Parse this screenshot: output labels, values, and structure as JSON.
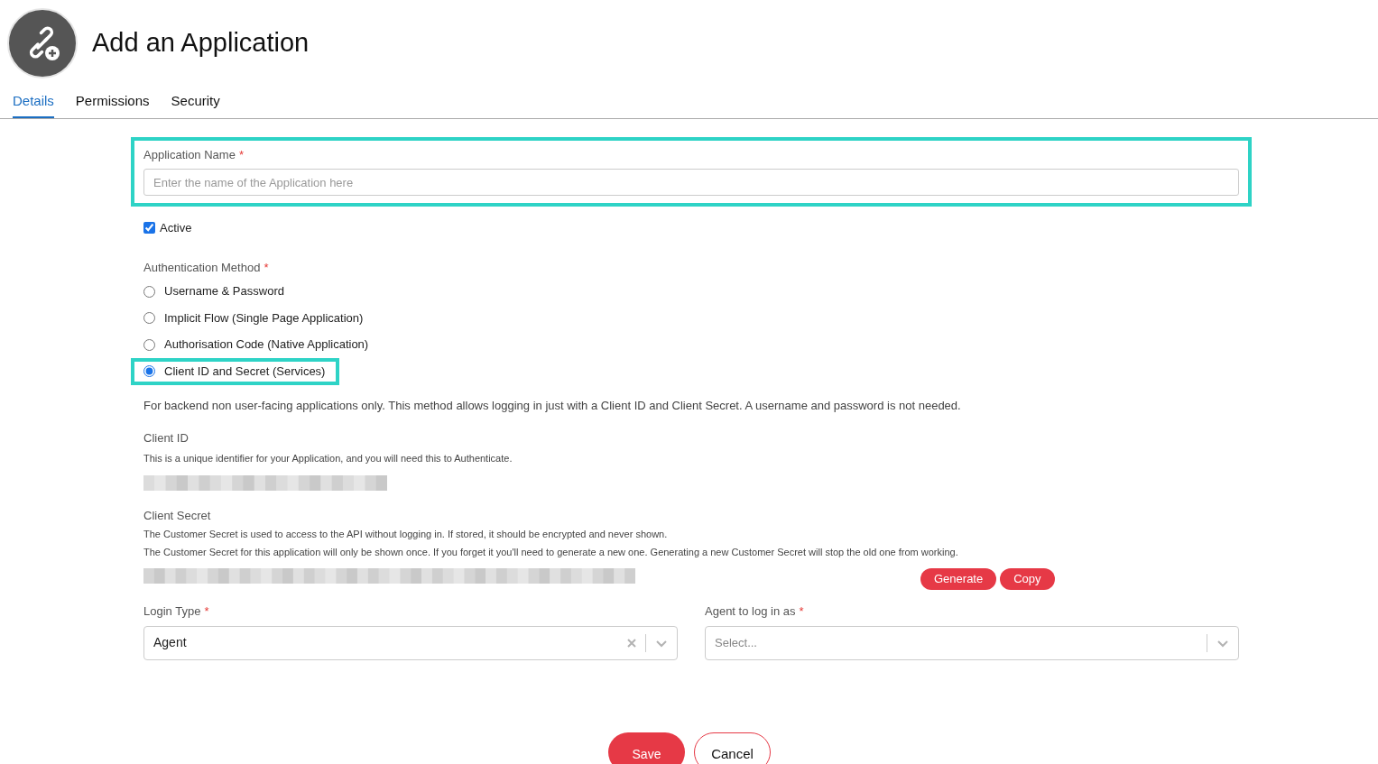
{
  "header": {
    "title": "Add an Application"
  },
  "tabs": [
    {
      "label": "Details",
      "selected": true
    },
    {
      "label": "Permissions",
      "selected": false
    },
    {
      "label": "Security",
      "selected": false
    }
  ],
  "application_name": {
    "label": "Application Name",
    "required": "*",
    "placeholder": "Enter the name of the Application here",
    "highlighted": true
  },
  "active": {
    "label": "Active",
    "checked": true
  },
  "authentication_method": {
    "label": "Authentication Method",
    "required": "*",
    "options": [
      {
        "label": "Username & Password",
        "selected": false,
        "highlighted": false
      },
      {
        "label": "Implicit Flow (Single Page Application)",
        "selected": false,
        "highlighted": false
      },
      {
        "label": "Authorisation Code (Native Application)",
        "selected": false,
        "highlighted": false
      },
      {
        "label": "Client ID and Secret (Services)",
        "selected": true,
        "highlighted": true
      }
    ]
  },
  "method_description": "For backend non user-facing applications only. This method allows logging in just with a Client ID and Client Secret. A username and password is not needed.",
  "client_id": {
    "label": "Client ID",
    "notes": [
      "This is a unique identifier for your Application, and you will need this to Authenticate."
    ]
  },
  "client_secret": {
    "label": "Client Secret",
    "notes": [
      "The Customer Secret is used to access to the API without logging in. If stored, it should be encrypted and never shown.",
      "The Customer Secret for this application will only be shown once. If you forget it you'll need to generate a new one. Generating a new Customer Secret will stop the old one from working."
    ],
    "buttons": [
      "Generate",
      "Copy"
    ]
  },
  "login_type": {
    "label": "Login Type",
    "required": "*",
    "value": "Agent",
    "clearable": true
  },
  "agent": {
    "label": "Agent to log in as",
    "required": "*",
    "placeholder": "Select...",
    "clearable": false
  },
  "footer_buttons": [
    {
      "label": "Save",
      "kind": "primary"
    },
    {
      "label": "Cancel",
      "kind": "secondary"
    }
  ]
}
